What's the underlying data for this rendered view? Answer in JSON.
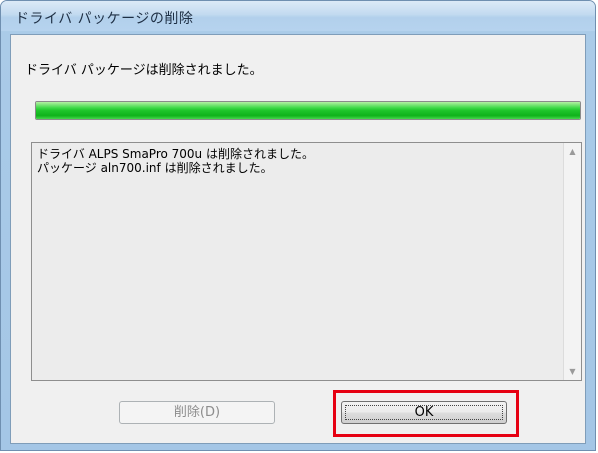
{
  "window": {
    "title": "ドライバ パッケージの削除"
  },
  "status": {
    "message": "ドライバ パッケージは削除されました。"
  },
  "progress": {
    "value_percent": 100,
    "color": "#1fc52b"
  },
  "log": {
    "lines": [
      "ドライバ ALPS SmaPro 700u は削除されました。",
      "パッケージ aln700.inf は削除されました。"
    ],
    "scroll_up_icon": "triangle-up-icon",
    "scroll_down_icon": "triangle-down-icon"
  },
  "buttons": {
    "delete": {
      "label": "削除(D)",
      "enabled": false
    },
    "ok": {
      "label": "OK",
      "enabled": true
    }
  },
  "highlight": {
    "color": "#e60012",
    "target": "ok-button"
  }
}
